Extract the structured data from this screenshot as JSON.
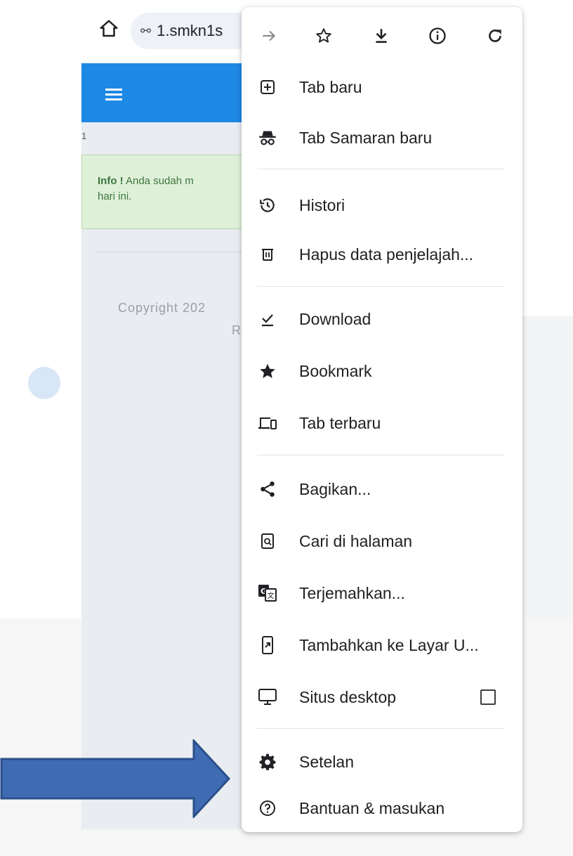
{
  "browser": {
    "url_text": "1.smkn1s",
    "toolbar_icons": [
      "home-icon",
      "tune-icon",
      "forward-icon",
      "star-icon",
      "download-icon",
      "info-icon",
      "reload-icon"
    ]
  },
  "site": {
    "row_number": "1",
    "alert_title": "Info !",
    "alert_text": " Anda sudah m",
    "alert_text2": "hari ini.",
    "copyright": "Copyright 202",
    "copyright2": "R"
  },
  "menu": {
    "items": [
      {
        "label": "Tab baru",
        "icon": "new-tab-icon"
      },
      {
        "label": "Tab Samaran baru",
        "icon": "incognito-icon"
      },
      {
        "label": "Histori",
        "icon": "history-icon"
      },
      {
        "label": "Hapus data penjelajah...",
        "icon": "trash-icon"
      },
      {
        "label": "Download",
        "icon": "downloads-icon"
      },
      {
        "label": "Bookmark",
        "icon": "bookmark-star-icon"
      },
      {
        "label": "Tab terbaru",
        "icon": "recent-tabs-icon"
      },
      {
        "label": "Bagikan...",
        "icon": "share-icon"
      },
      {
        "label": "Cari di halaman",
        "icon": "find-in-page-icon"
      },
      {
        "label": "Terjemahkan...",
        "icon": "translate-icon"
      },
      {
        "label": "Tambahkan ke Layar U...",
        "icon": "add-to-home-icon"
      },
      {
        "label": "Situs desktop",
        "icon": "desktop-icon",
        "checked": false
      },
      {
        "label": "Setelan",
        "icon": "settings-gear-icon"
      },
      {
        "label": "Bantuan & masukan",
        "icon": "help-icon"
      }
    ]
  },
  "annotation": {
    "arrow_color": "#3f6bb3",
    "arrow_target": "Setelan"
  }
}
